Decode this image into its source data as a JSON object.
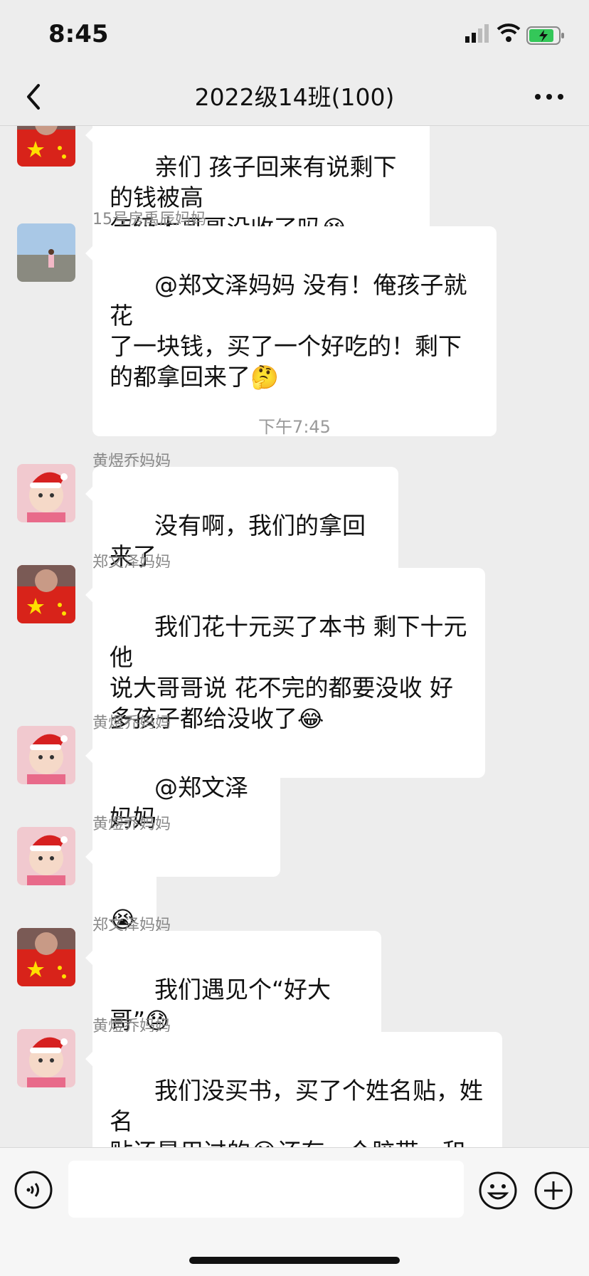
{
  "status": {
    "time": "8:45"
  },
  "nav": {
    "title": "2022级14班(100)"
  },
  "timestamp": "下午7:45",
  "messages": [
    {
      "sender": "",
      "avatar": "flag-avatar",
      "text": "亲们 孩子回来有说剩下的钱被高\n年级大哥哥没收了吗",
      "emoji": "😭"
    },
    {
      "sender": "15号房禹辰妈妈",
      "avatar": "beach-avatar",
      "text": "@郑文泽妈妈 没有！俺孩子就花\n了一块钱，买了一个好吃的！剩下\n的都拿回来了",
      "emoji": "🤔"
    },
    {
      "sender": "黄煜乔妈妈",
      "avatar": "baby-santa-avatar",
      "text": "没有啊，我们的拿回来了",
      "emoji": ""
    },
    {
      "sender": "郑文泽妈妈",
      "avatar": "flag-avatar",
      "text": "我们花十元买了本书 剩下十元 他\n说大哥哥说 花不完的都要没收 好\n多孩子都给没收了",
      "emoji": "😂"
    },
    {
      "sender": "黄煜乔妈妈",
      "avatar": "baby-santa-avatar",
      "text": "@郑文泽妈妈",
      "emoji": ""
    },
    {
      "sender": "黄煜乔妈妈",
      "avatar": "baby-santa-avatar",
      "text": "",
      "emoji": "😭"
    },
    {
      "sender": "郑文泽妈妈",
      "avatar": "flag-avatar",
      "text": "我们遇见个“好大哥”",
      "emoji": "😓"
    },
    {
      "sender": "黄煜乔妈妈",
      "avatar": "baby-santa-avatar",
      "text": "我们没买书，买了个姓名贴，姓名\n贴还是用过的😭还有一个胶带，和\n一个印章。然后钱就带回来了",
      "emoji": "🤔"
    }
  ]
}
